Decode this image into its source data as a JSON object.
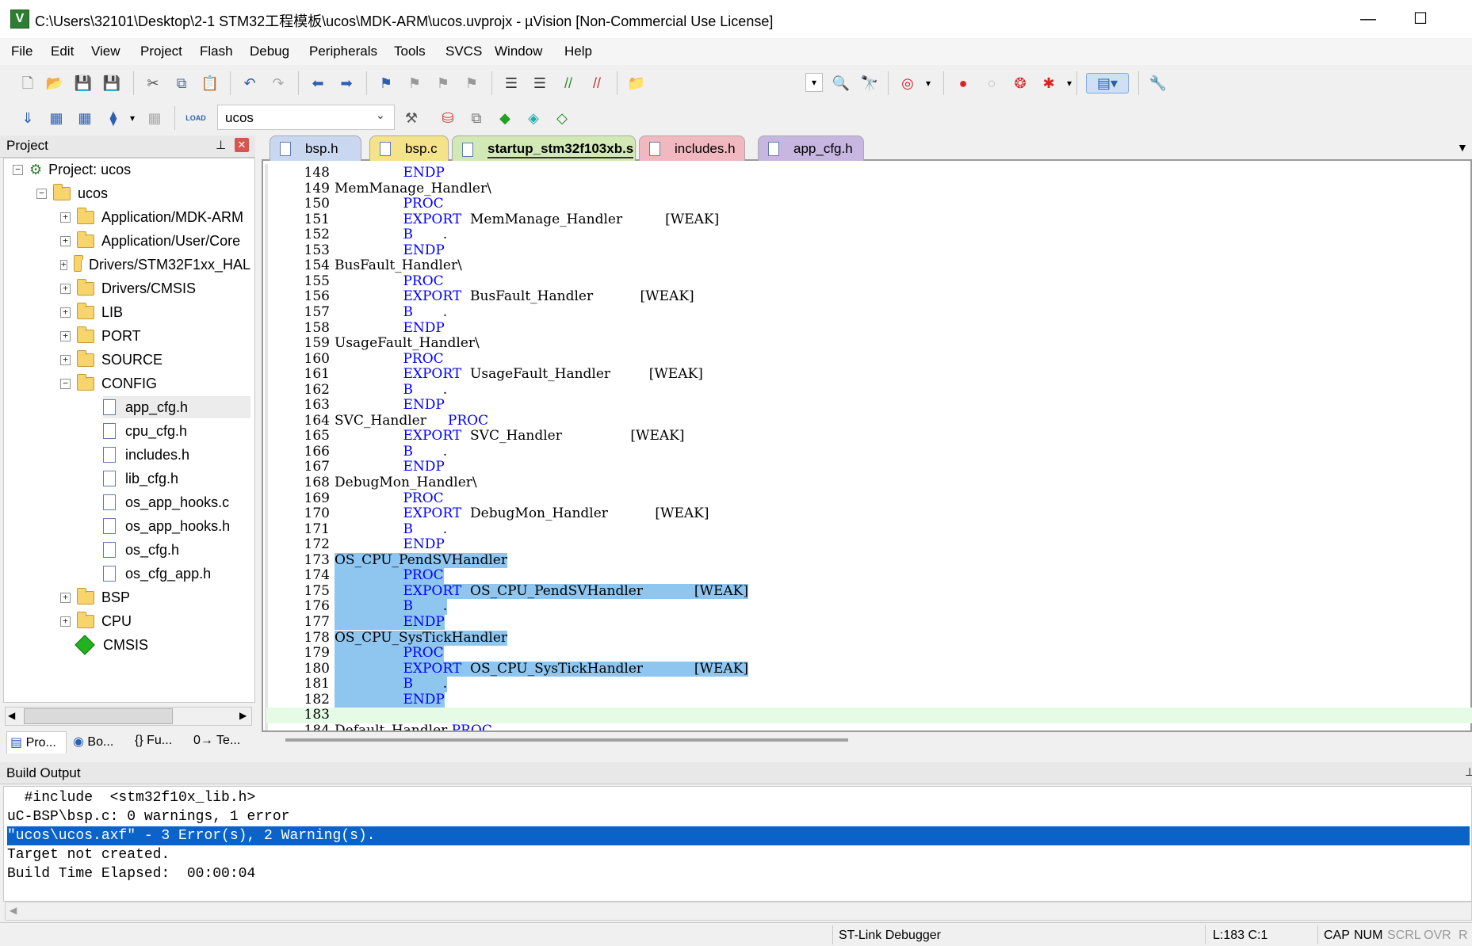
{
  "window": {
    "title": "C:\\Users\\32101\\Desktop\\2-1 STM32工程模板\\ucos\\MDK-ARM\\ucos.uvprojx - µVision  [Non-Commercial Use License]",
    "app_icon_letter": "V",
    "minimize": "—",
    "maximize": "☐"
  },
  "menu": [
    "File",
    "Edit",
    "View",
    "Project",
    "Flash",
    "Debug",
    "Peripherals",
    "Tools",
    "SVCS",
    "Window",
    "Help"
  ],
  "toolbar2": {
    "target": "ucos",
    "load_label": "LOAD"
  },
  "project_panel": {
    "title": "Project",
    "pin": "📌",
    "close": "✕",
    "root": "Project: ucos",
    "target": "ucos",
    "groups_before": [
      "Application/MDK-ARM",
      "Application/User/Core",
      "Drivers/STM32F1xx_HAL",
      "Drivers/CMSIS",
      "LIB",
      "PORT",
      "SOURCE"
    ],
    "config_group": "CONFIG",
    "config_files": [
      "app_cfg.h",
      "cpu_cfg.h",
      "includes.h",
      "lib_cfg.h",
      "os_app_hooks.c",
      "os_app_hooks.h",
      "os_cfg.h",
      "os_cfg_app.h"
    ],
    "groups_after": [
      "BSP",
      "CPU"
    ],
    "cmsis": "CMSIS",
    "tabs": [
      "Pro...",
      "Bo...",
      "{} Fu...",
      "0→ Te..."
    ]
  },
  "editor_tabs": [
    {
      "label": "bsp.h",
      "color": "#c9d8f0"
    },
    {
      "label": "bsp.c",
      "color": "#f5e38a"
    },
    {
      "label": "startup_stm32f103xb.s",
      "color": "#d3e9b5"
    },
    {
      "label": "includes.h",
      "color": "#f2b8c0"
    },
    {
      "label": "app_cfg.h",
      "color": "#c7b6e0"
    }
  ],
  "code": [
    {
      "n": "148",
      "t": "                ENDP"
    },
    {
      "n": "149",
      "t": "MemManage_Handler\\"
    },
    {
      "n": "150",
      "t": "                PROC"
    },
    {
      "n": "151",
      "t": "                EXPORT  MemManage_Handler          [WEAK]"
    },
    {
      "n": "152",
      "t": "                B       ."
    },
    {
      "n": "153",
      "t": "                ENDP"
    },
    {
      "n": "154",
      "t": "BusFault_Handler\\"
    },
    {
      "n": "155",
      "t": "                PROC"
    },
    {
      "n": "156",
      "t": "                EXPORT  BusFault_Handler           [WEAK]"
    },
    {
      "n": "157",
      "t": "                B       ."
    },
    {
      "n": "158",
      "t": "                ENDP"
    },
    {
      "n": "159",
      "t": "UsageFault_Handler\\"
    },
    {
      "n": "160",
      "t": "                PROC"
    },
    {
      "n": "161",
      "t": "                EXPORT  UsageFault_Handler         [WEAK]"
    },
    {
      "n": "162",
      "t": "                B       ."
    },
    {
      "n": "163",
      "t": "                ENDP"
    },
    {
      "n": "164",
      "t": "SVC_Handler     PROC"
    },
    {
      "n": "165",
      "t": "                EXPORT  SVC_Handler                [WEAK]"
    },
    {
      "n": "166",
      "t": "                B       ."
    },
    {
      "n": "167",
      "t": "                ENDP"
    },
    {
      "n": "168",
      "t": "DebugMon_Handler\\"
    },
    {
      "n": "169",
      "t": "                PROC"
    },
    {
      "n": "170",
      "t": "                EXPORT  DebugMon_Handler           [WEAK]"
    },
    {
      "n": "171",
      "t": "                B       ."
    },
    {
      "n": "172",
      "t": "                ENDP"
    },
    {
      "n": "173",
      "t": "OS_CPU_PendSVHandler"
    },
    {
      "n": "174",
      "t": "                PROC"
    },
    {
      "n": "175",
      "t": "                EXPORT  OS_CPU_PendSVHandler            [WEAK]"
    },
    {
      "n": "176",
      "t": "                B       ."
    },
    {
      "n": "177",
      "t": "                ENDP"
    },
    {
      "n": "178",
      "t": "OS_CPU_SysTickHandler"
    },
    {
      "n": "179",
      "t": "                PROC"
    },
    {
      "n": "180",
      "t": "                EXPORT  OS_CPU_SysTickHandler            [WEAK]"
    },
    {
      "n": "181",
      "t": "                B       ."
    },
    {
      "n": "182",
      "t": "                ENDP"
    },
    {
      "n": "183",
      "t": ""
    },
    {
      "n": "184",
      "t": "Default_Handler PROC"
    }
  ],
  "build_output": {
    "title": "Build Output",
    "lines": [
      "  #include  <stm32f10x_lib.h>",
      "uC-BSP\\bsp.c: 0 warnings, 1 error",
      "\"ucos\\ucos.axf\" - 3 Error(s), 2 Warning(s).",
      "Target not created.",
      "Build Time Elapsed:  00:00:04"
    ],
    "selected_index": 2
  },
  "status": {
    "debugger": "ST-Link Debugger",
    "position": "L:183 C:1",
    "cap": "CAP",
    "num": "NUM",
    "scrl": "SCRL",
    "ovr": "OVR",
    "rw": "R"
  },
  "colors": {
    "selection": "#8ec6f0",
    "build_selection": "#0a63c9",
    "keyword": "#0000ff",
    "current_line": "#e6fbe6"
  }
}
